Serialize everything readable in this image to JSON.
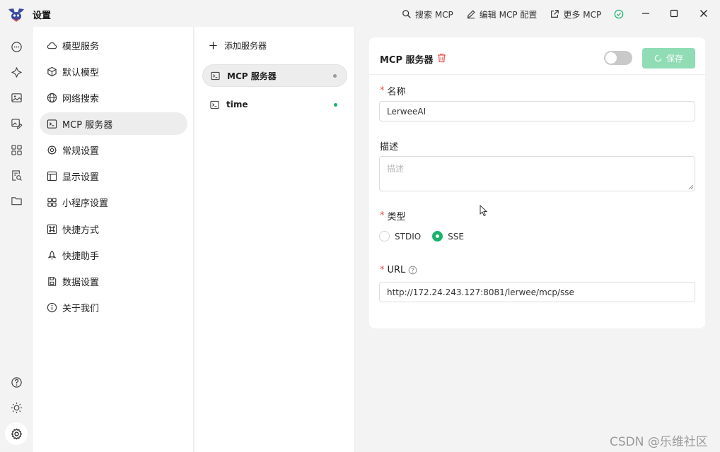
{
  "titlebar": {
    "app_title": "设置",
    "actions": [
      {
        "icon": "search-icon",
        "label": "搜索 MCP"
      },
      {
        "icon": "edit-icon",
        "label": "编辑 MCP 配置"
      },
      {
        "icon": "external-link-icon",
        "label": "更多 MCP"
      }
    ],
    "status_icon": "check-circle-icon"
  },
  "rail": {
    "items": [
      "chat-icon",
      "sparkle-icon",
      "image-icon",
      "image-edit-icon",
      "apps-grid-icon",
      "document-search-icon",
      "folder-icon"
    ],
    "bottom": [
      "help-icon",
      "brightness-icon",
      "settings-icon"
    ]
  },
  "settings_menu": {
    "items": [
      {
        "icon": "cloud-icon",
        "label": "模型服务"
      },
      {
        "icon": "cube-icon",
        "label": "默认模型"
      },
      {
        "icon": "globe-icon",
        "label": "网络搜索"
      },
      {
        "icon": "terminal-icon",
        "label": "MCP 服务器"
      },
      {
        "icon": "gear-icon",
        "label": "常规设置"
      },
      {
        "icon": "layout-icon",
        "label": "显示设置"
      },
      {
        "icon": "grid-icon",
        "label": "小程序设置"
      },
      {
        "icon": "command-icon",
        "label": "快捷方式"
      },
      {
        "icon": "rocket-icon",
        "label": "快捷助手"
      },
      {
        "icon": "database-icon",
        "label": "数据设置"
      },
      {
        "icon": "info-icon",
        "label": "关于我们"
      }
    ],
    "active_index": 3
  },
  "server_list": {
    "add_label": "添加服务器",
    "items": [
      {
        "label": "MCP 服务器",
        "status_color": "#999999",
        "active": true
      },
      {
        "label": "time",
        "status_color": "#19b36b",
        "active": false
      }
    ]
  },
  "detail": {
    "title": "MCP 服务器",
    "enabled": false,
    "save_label": "保存",
    "name": {
      "label": "名称",
      "required": "*",
      "value": "LerweeAI"
    },
    "description": {
      "label": "描述",
      "placeholder": "描述"
    },
    "type": {
      "label": "类型",
      "required": "*",
      "options": [
        "STDIO",
        "SSE"
      ],
      "selected": "SSE"
    },
    "url": {
      "label": "URL",
      "required": "*",
      "value": "http://172.24.243.127:8081/lerwee/mcp/sse"
    }
  },
  "colors": {
    "accent": "#19b36b",
    "save_button": "#8fdcb5",
    "danger": "#e55353"
  },
  "watermark": "CSDN @乐维社区"
}
